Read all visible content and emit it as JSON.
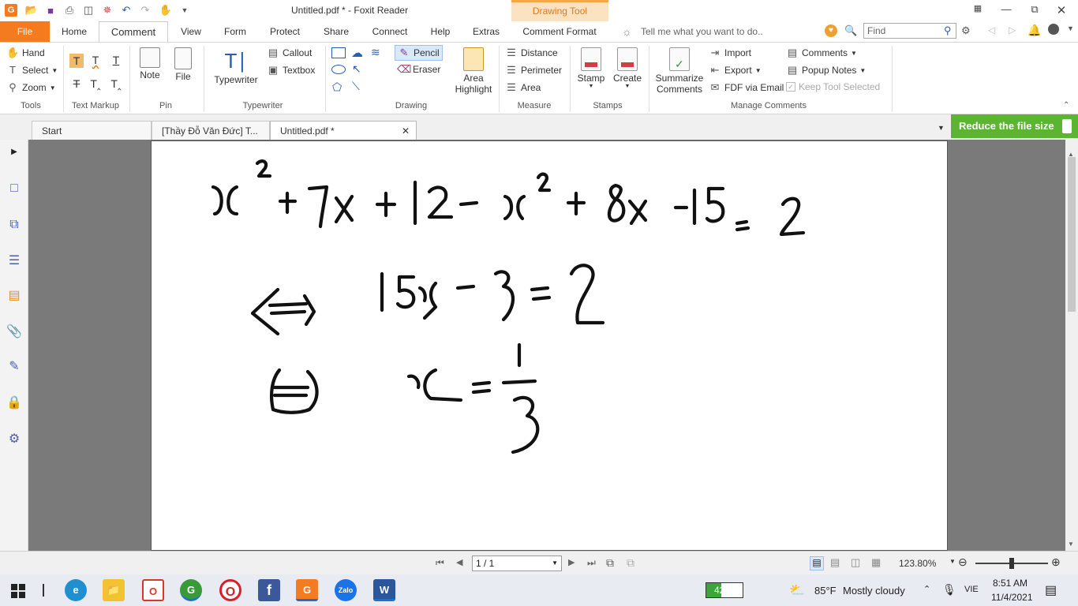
{
  "window": {
    "title": "Untitled.pdf * - Foxit Reader",
    "context_tab": "Drawing Tool"
  },
  "menu_tabs": [
    "File",
    "Home",
    "Comment",
    "View",
    "Form",
    "Protect",
    "Share",
    "Connect",
    "Help",
    "Extras",
    "Comment Format"
  ],
  "search": {
    "tell_me_placeholder": "Tell me what you want to do..",
    "find_placeholder": "Find"
  },
  "ribbon": {
    "tools": {
      "label": "Tools",
      "hand": "Hand",
      "select": "Select",
      "zoom": "Zoom"
    },
    "text_markup": {
      "label": "Text Markup"
    },
    "pin": {
      "label": "Pin",
      "note": "Note",
      "file": "File"
    },
    "typewriter": {
      "label": "Typewriter",
      "typewriter": "Typewriter",
      "callout": "Callout",
      "textbox": "Textbox"
    },
    "drawing": {
      "label": "Drawing",
      "pencil": "Pencil",
      "eraser": "Eraser",
      "area_highlight_1": "Area",
      "area_highlight_2": "Highlight"
    },
    "measure": {
      "label": "Measure",
      "distance": "Distance",
      "perimeter": "Perimeter",
      "area": "Area"
    },
    "stamps": {
      "label": "Stamps",
      "stamp": "Stamp",
      "create": "Create"
    },
    "manage_comments": {
      "label": "Manage Comments",
      "summarize_1": "Summarize",
      "summarize_2": "Comments",
      "import": "Import",
      "export": "Export",
      "fdf_email": "FDF via Email",
      "comments": "Comments",
      "popup_notes": "Popup Notes",
      "keep_tool": "Keep Tool Selected"
    }
  },
  "doc_tabs": [
    "Start",
    "[Thầy Đỗ Văn Đức] T...",
    "Untitled.pdf *"
  ],
  "reduce_banner": "Reduce the file size",
  "status": {
    "page_field": "1 / 1",
    "zoom": "123.80%"
  },
  "taskbar": {
    "battery": "42%",
    "weather_temp": "85°F",
    "weather_text": "Mostly cloudy",
    "language": "VIE",
    "time": "8:51 AM",
    "date": "11/4/2021"
  },
  "colors": {
    "accent": "#f47b20",
    "green_banner": "#5cb531",
    "context_tab": "#fbe3c1"
  }
}
